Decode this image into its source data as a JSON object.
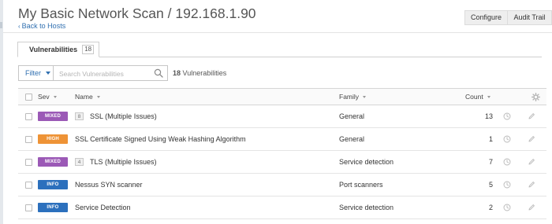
{
  "page": {
    "title": "My Basic Network Scan / 192.168.1.90",
    "back_chevron": "‹",
    "back_label": "Back to Hosts"
  },
  "toolbar": {
    "configure_label": "Configure",
    "audit_trail_label": "Audit Trail"
  },
  "tabs": [
    {
      "label": "Vulnerabilities",
      "count": "18"
    }
  ],
  "filter": {
    "label": "Filter",
    "search_placeholder": "Search Vulnerabilities",
    "search_value": "",
    "summary_count": "18",
    "summary_label": "Vulnerabilities"
  },
  "table": {
    "columns": {
      "sev": "Sev",
      "name": "Name",
      "family": "Family",
      "count": "Count"
    },
    "rows": [
      {
        "severity": "MIXED",
        "severity_color": "#9b59b6",
        "group_count": "8",
        "name": "SSL (Multiple Issues)",
        "family": "General",
        "count": "13"
      },
      {
        "severity": "HIGH",
        "severity_color": "#ee9336",
        "group_count": "",
        "name": "SSL Certificate Signed Using Weak Hashing Algorithm",
        "family": "General",
        "count": "1"
      },
      {
        "severity": "MIXED",
        "severity_color": "#9b59b6",
        "group_count": "4",
        "name": "TLS (Multiple Issues)",
        "family": "Service detection",
        "count": "7"
      },
      {
        "severity": "INFO",
        "severity_color": "#2c70bd",
        "group_count": "",
        "name": "Nessus SYN scanner",
        "family": "Port scanners",
        "count": "5"
      },
      {
        "severity": "INFO",
        "severity_color": "#2c70bd",
        "group_count": "",
        "name": "Service Detection",
        "family": "Service detection",
        "count": "2"
      }
    ]
  },
  "icons": {
    "back": "chevron-left-icon",
    "filter_caret": "caret-down-icon",
    "search": "search-icon",
    "settings": "gear-icon",
    "row_snooze": "clock-icon",
    "row_edit": "pencil-icon"
  },
  "colors": {
    "link": "#2f6fb0",
    "mixed": "#9b59b6",
    "high": "#ee9336",
    "info": "#2c70bd"
  }
}
